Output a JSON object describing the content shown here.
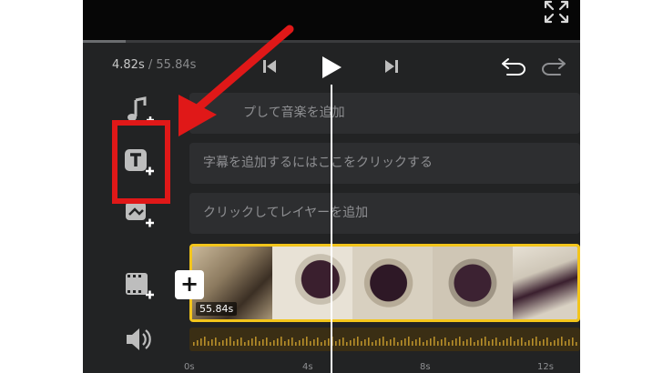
{
  "player": {
    "current_time": "4.82s",
    "separator": "/",
    "total_time": "55.84s",
    "progress": 0.086
  },
  "tracks": {
    "music_row_label": "プして音楽を追加",
    "caption_row_label": "字幕を追加するにはここをクリックする",
    "layer_row_label": "クリックしてレイヤーを追加"
  },
  "video_clip": {
    "duration_label": "55.84s"
  },
  "add_clip_label": "+",
  "ruler": {
    "ticks": [
      "0s",
      "4s",
      "8s",
      "12s"
    ]
  },
  "icons": {
    "fullscreen": "fullscreen-icon",
    "prev": "skip-previous-icon",
    "play": "play-icon",
    "next": "skip-next-icon",
    "undo": "undo-icon",
    "redo": "redo-icon",
    "music": "add-music-icon",
    "text": "add-text-icon",
    "layer": "add-layer-icon",
    "video": "add-video-icon",
    "volume": "volume-icon"
  },
  "colors": {
    "app_bg": "#222324",
    "clip_border": "#f3c51b",
    "annotation_red": "#e01818"
  }
}
